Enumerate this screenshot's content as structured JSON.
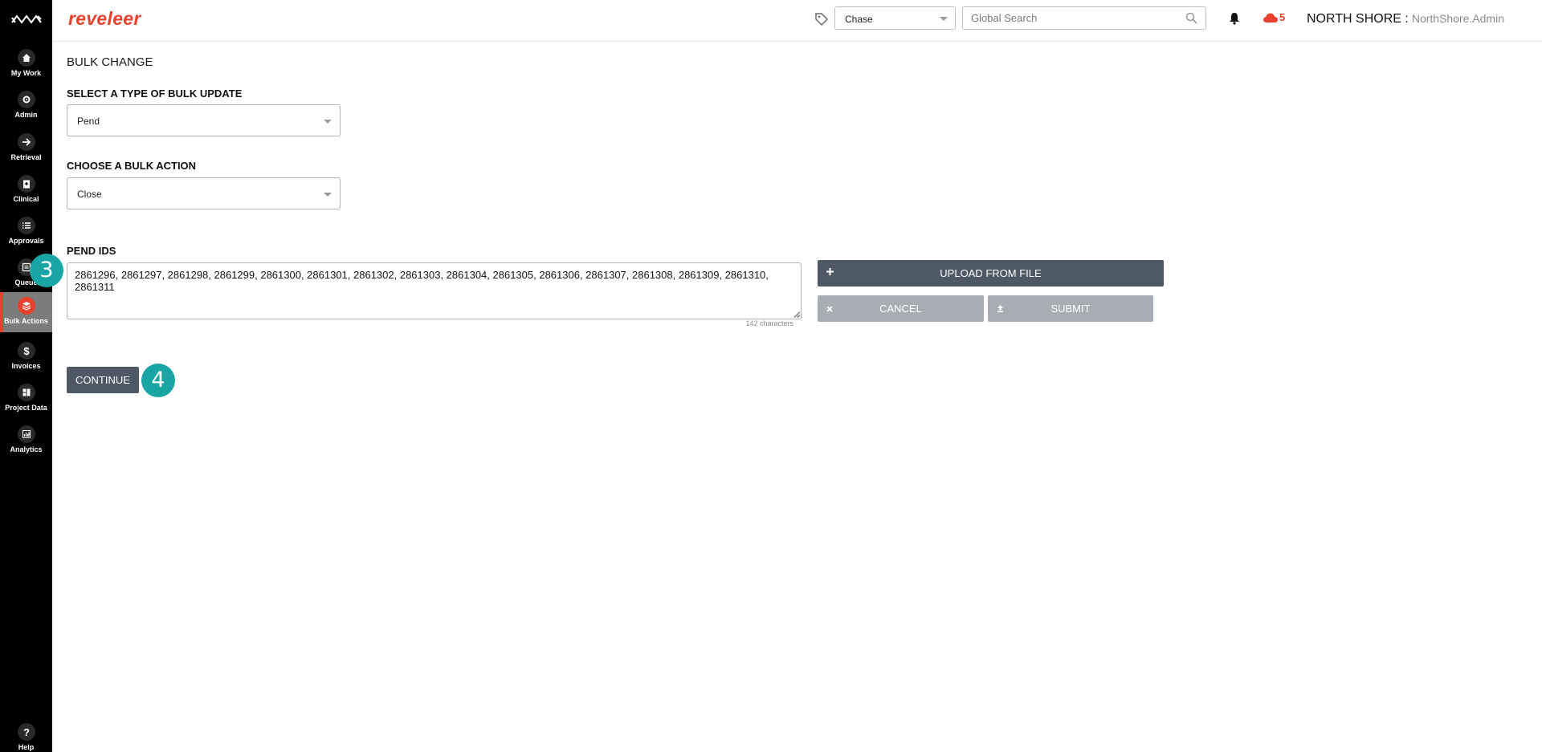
{
  "sidebar": {
    "items": [
      {
        "label": "My Work",
        "icon": "home-icon"
      },
      {
        "label": "Admin",
        "icon": "gear-icon"
      },
      {
        "label": "Retrieval",
        "icon": "arrow-right-icon"
      },
      {
        "label": "Clinical",
        "icon": "clipboard-icon"
      },
      {
        "label": "Approvals",
        "icon": "list-icon"
      },
      {
        "label": "Queue",
        "icon": "queue-icon"
      },
      {
        "label": "Bulk Actions",
        "icon": "layers-icon",
        "active": true
      },
      {
        "label": "Invoices",
        "icon": "dollar-icon"
      },
      {
        "label": "Project Data",
        "icon": "folder-icon"
      },
      {
        "label": "Analytics",
        "icon": "chart-icon"
      }
    ],
    "help": {
      "label": "Help",
      "icon": "help-icon"
    }
  },
  "header": {
    "brand": "reveleer",
    "entity_select": "Chase",
    "search_placeholder": "Global Search",
    "notification_count": "5",
    "org": "NORTH SHORE :",
    "user": "NorthShore.Admin"
  },
  "main": {
    "title": "BULK CHANGE",
    "bulk_update_label": "SELECT A TYPE OF BULK UPDATE",
    "bulk_update_value": "Pend",
    "bulk_action_label": "CHOOSE A BULK ACTION",
    "bulk_action_value": "Close",
    "ids_label": "PEND IDS",
    "ids_value": "2861296, 2861297, 2861298, 2861299, 2861300, 2861301, 2861302, 2861303, 2861304, 2861305, 2861306, 2861307, 2861308, 2861309, 2861310, 2861311",
    "char_count": "142 characters",
    "upload_label": "UPLOAD FROM FILE",
    "cancel_label": "CANCEL",
    "submit_label": "SUBMIT",
    "continue_label": "CONTINUE"
  },
  "annotations": {
    "step_3": "3",
    "step_4": "4",
    "color": "#1aa5a5"
  },
  "colors": {
    "brand": "#e8412c",
    "primary_button": "#4d5a66",
    "disabled_button": "#a7adb3"
  }
}
